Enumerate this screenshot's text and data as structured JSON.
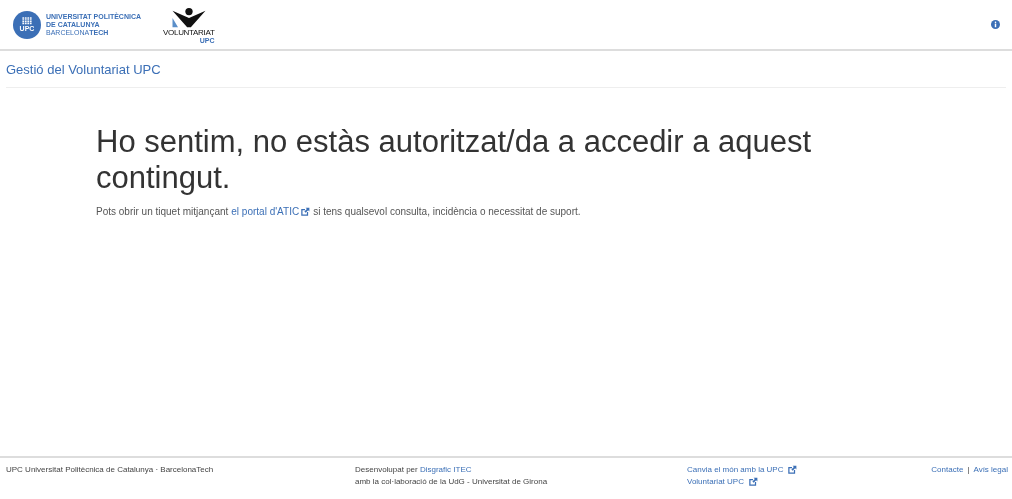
{
  "header": {
    "upc_logo": {
      "badge": "UPC",
      "lines": [
        "UNIVERSITAT POLITÈCNICA",
        "DE CATALUNYA",
        "BARCELONA**TECH**"
      ]
    },
    "voluntariat_logo": {
      "name": "VOLUNTARIAT",
      "sub": "UPC"
    }
  },
  "app_title": "Gestió del Voluntariat UPC",
  "message": {
    "heading": "Ho sentim, no estàs autoritzat/da a accedir a aquest contingut.",
    "before": "Pots obrir un tiquet mitjançant",
    "link": "el portal d'ATIC",
    "after": "si tens qualsevol consulta, incidència o necessitat de suport."
  },
  "footer": {
    "copyright": "UPC Universitat Politècnica de Catalunya · BarcelonaTech",
    "developed_by": "Desenvolupat per",
    "developer_link": "Disgrafic ITEC",
    "collaboration": "amb la col·laboració de la UdG - Universitat de Girona",
    "external_links": [
      "Canvia el món amb la UPC",
      "Voluntariat UPC"
    ],
    "legal_links": [
      "Contacte",
      "Avís legal"
    ],
    "separator": "|"
  }
}
